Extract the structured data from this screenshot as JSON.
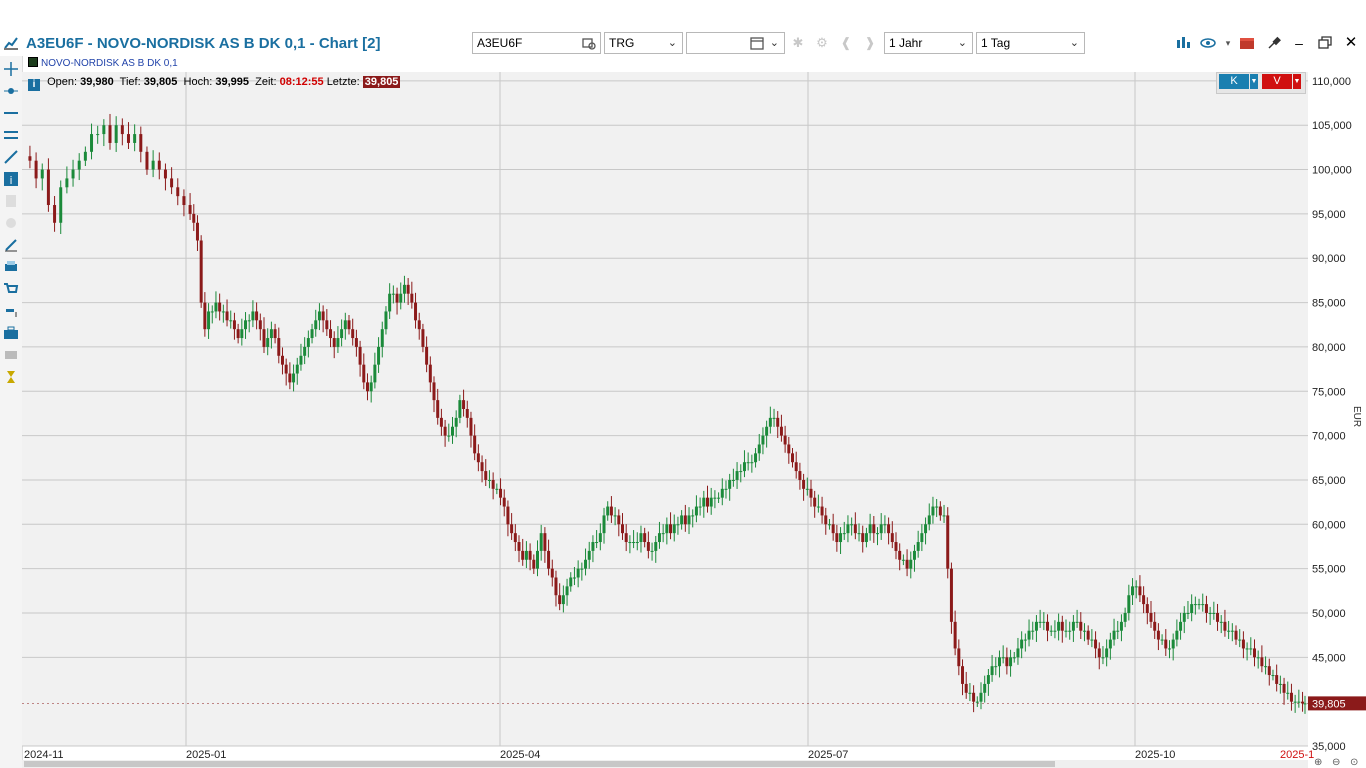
{
  "window": {
    "title": "A3EU6F - NOVO-NORDISK AS B  DK 0,1 - Chart [2]"
  },
  "toolbar": {
    "symbol_value": "A3EU6F",
    "exchange_value": "TRG",
    "date_value": "",
    "range_value": "1 Jahr",
    "interval_value": "1 Tag"
  },
  "series_label": "NOVO-NORDISK AS B  DK 0,1",
  "info": {
    "open_label": "Open:",
    "open_value": "39,980",
    "low_label": "Tief:",
    "low_value": "39,805",
    "high_label": "Hoch:",
    "high_value": "39,995",
    "time_label": "Zeit:",
    "time_value": "08:12:55",
    "last_label": "Letzte:",
    "last_value": "39,805"
  },
  "trade_buttons": {
    "buy": "K",
    "sell": "V"
  },
  "colors": {
    "up": "#1b8a3a",
    "down": "#8b1a1a",
    "grid": "#c8c8c8",
    "bg": "#f1f1f1",
    "last_price_bg": "#8b1a1a",
    "accent": "#1a6fa0"
  },
  "chart_data": {
    "type": "candlestick",
    "currency_label": "EUR",
    "ylim": [
      35,
      111
    ],
    "y_ticks": [
      "110,000",
      "105,000",
      "100,000",
      "95,000",
      "90,000",
      "85,000",
      "80,000",
      "75,000",
      "70,000",
      "65,000",
      "60,000",
      "55,000",
      "50,000",
      "45,000",
      "39,805",
      "35,000"
    ],
    "x_ticks": [
      "2024-11",
      "2025-01",
      "2025-04",
      "2025-07",
      "2025-10",
      "2025-1"
    ],
    "last_price": 39.805,
    "path_points": [
      [
        0,
        101.5
      ],
      [
        4,
        101
      ],
      [
        9,
        99
      ],
      [
        14,
        100
      ],
      [
        19,
        96
      ],
      [
        24,
        94
      ],
      [
        29,
        98
      ],
      [
        34,
        99
      ],
      [
        39,
        100
      ],
      [
        44,
        101
      ],
      [
        49,
        102
      ],
      [
        54,
        104
      ],
      [
        59,
        104
      ],
      [
        64,
        105
      ],
      [
        69,
        103
      ],
      [
        74,
        105
      ],
      [
        79,
        104
      ],
      [
        84,
        103
      ],
      [
        89,
        104
      ],
      [
        94,
        102
      ],
      [
        99,
        100
      ],
      [
        104,
        101
      ],
      [
        109,
        100
      ],
      [
        114,
        99
      ],
      [
        119,
        98
      ],
      [
        124,
        97
      ],
      [
        129,
        96
      ],
      [
        134,
        95
      ],
      [
        137,
        94
      ],
      [
        140,
        92
      ],
      [
        143,
        85
      ],
      [
        146,
        82
      ],
      [
        149,
        84
      ],
      [
        152,
        84
      ],
      [
        155,
        85
      ],
      [
        158,
        84
      ],
      [
        161,
        84
      ],
      [
        164,
        83
      ],
      [
        167,
        83
      ],
      [
        170,
        82
      ],
      [
        173,
        81
      ],
      [
        176,
        82
      ],
      [
        179,
        83
      ],
      [
        182,
        83
      ],
      [
        185,
        84
      ],
      [
        188,
        83
      ],
      [
        191,
        82
      ],
      [
        194,
        80
      ],
      [
        197,
        81
      ],
      [
        200,
        82
      ],
      [
        203,
        81
      ],
      [
        206,
        79
      ],
      [
        209,
        78
      ],
      [
        212,
        77
      ],
      [
        215,
        76
      ],
      [
        218,
        77
      ],
      [
        221,
        78
      ],
      [
        224,
        79
      ],
      [
        227,
        80
      ],
      [
        230,
        81
      ],
      [
        233,
        82
      ],
      [
        236,
        83
      ],
      [
        239,
        84
      ],
      [
        242,
        83
      ],
      [
        245,
        82
      ],
      [
        248,
        81
      ],
      [
        251,
        80
      ],
      [
        254,
        81
      ],
      [
        257,
        82
      ],
      [
        260,
        83
      ],
      [
        263,
        82
      ],
      [
        266,
        81
      ],
      [
        269,
        80
      ],
      [
        272,
        78
      ],
      [
        275,
        76
      ],
      [
        278,
        75
      ],
      [
        281,
        76
      ],
      [
        284,
        78
      ],
      [
        287,
        80
      ],
      [
        290,
        82
      ],
      [
        293,
        84
      ],
      [
        296,
        86
      ],
      [
        299,
        86
      ],
      [
        302,
        85
      ],
      [
        305,
        86
      ],
      [
        308,
        87
      ],
      [
        311,
        86
      ],
      [
        314,
        85
      ],
      [
        317,
        83
      ],
      [
        320,
        82
      ],
      [
        323,
        80
      ],
      [
        326,
        78
      ],
      [
        329,
        76
      ],
      [
        332,
        74
      ],
      [
        335,
        72
      ],
      [
        338,
        71
      ],
      [
        341,
        70
      ],
      [
        344,
        70
      ],
      [
        347,
        71
      ],
      [
        350,
        72
      ],
      [
        353,
        74
      ],
      [
        356,
        73
      ],
      [
        359,
        72
      ],
      [
        362,
        70
      ],
      [
        365,
        68
      ],
      [
        368,
        67
      ],
      [
        371,
        66
      ],
      [
        374,
        65
      ],
      [
        377,
        65
      ],
      [
        380,
        64
      ],
      [
        383,
        64
      ],
      [
        386,
        63
      ],
      [
        389,
        62
      ],
      [
        392,
        60
      ],
      [
        395,
        59
      ],
      [
        398,
        58
      ],
      [
        401,
        57
      ],
      [
        404,
        56
      ],
      [
        407,
        57
      ],
      [
        410,
        56
      ],
      [
        413,
        55
      ],
      [
        416,
        57
      ],
      [
        419,
        59
      ],
      [
        422,
        57
      ],
      [
        425,
        55
      ],
      [
        428,
        54
      ],
      [
        431,
        52
      ],
      [
        434,
        51
      ],
      [
        437,
        52
      ],
      [
        440,
        53
      ],
      [
        443,
        54
      ],
      [
        446,
        54
      ],
      [
        449,
        55
      ],
      [
        452,
        55
      ],
      [
        455,
        56
      ],
      [
        458,
        57
      ],
      [
        461,
        58
      ],
      [
        464,
        58
      ],
      [
        467,
        59
      ],
      [
        470,
        61
      ],
      [
        473,
        62
      ],
      [
        476,
        61
      ],
      [
        479,
        61
      ],
      [
        482,
        60
      ],
      [
        485,
        59
      ],
      [
        488,
        58
      ],
      [
        491,
        58
      ],
      [
        494,
        58
      ],
      [
        497,
        58
      ],
      [
        500,
        59
      ],
      [
        503,
        58
      ],
      [
        506,
        57
      ],
      [
        509,
        57
      ],
      [
        512,
        58
      ],
      [
        515,
        59
      ],
      [
        518,
        59
      ],
      [
        521,
        60
      ],
      [
        524,
        59
      ],
      [
        527,
        60
      ],
      [
        530,
        60
      ],
      [
        533,
        61
      ],
      [
        536,
        60
      ],
      [
        539,
        61
      ],
      [
        542,
        61
      ],
      [
        545,
        62
      ],
      [
        548,
        62
      ],
      [
        551,
        63
      ],
      [
        554,
        62
      ],
      [
        557,
        63
      ],
      [
        560,
        63
      ],
      [
        563,
        63
      ],
      [
        566,
        64
      ],
      [
        569,
        64
      ],
      [
        572,
        65
      ],
      [
        575,
        65
      ],
      [
        578,
        66
      ],
      [
        581,
        66
      ],
      [
        584,
        67
      ],
      [
        587,
        67
      ],
      [
        590,
        67
      ],
      [
        593,
        68
      ],
      [
        596,
        69
      ],
      [
        599,
        70
      ],
      [
        602,
        71
      ],
      [
        605,
        72
      ],
      [
        608,
        72
      ],
      [
        611,
        71
      ],
      [
        614,
        70
      ],
      [
        617,
        69
      ],
      [
        620,
        68
      ],
      [
        623,
        67
      ],
      [
        626,
        66
      ],
      [
        629,
        65
      ],
      [
        632,
        64
      ],
      [
        635,
        64
      ],
      [
        638,
        63
      ],
      [
        641,
        62
      ],
      [
        644,
        62
      ],
      [
        647,
        61
      ],
      [
        650,
        60
      ],
      [
        653,
        60
      ],
      [
        656,
        59
      ],
      [
        659,
        58
      ],
      [
        662,
        59
      ],
      [
        665,
        59
      ],
      [
        668,
        60
      ],
      [
        671,
        60
      ],
      [
        674,
        59
      ],
      [
        677,
        59
      ],
      [
        680,
        58
      ],
      [
        683,
        59
      ],
      [
        686,
        60
      ],
      [
        689,
        59
      ],
      [
        692,
        59
      ],
      [
        695,
        60
      ],
      [
        698,
        60
      ],
      [
        701,
        59
      ],
      [
        704,
        58
      ],
      [
        707,
        57
      ],
      [
        710,
        56
      ],
      [
        713,
        56
      ],
      [
        716,
        55
      ],
      [
        719,
        56
      ],
      [
        722,
        57
      ],
      [
        725,
        58
      ],
      [
        728,
        59
      ],
      [
        731,
        60
      ],
      [
        734,
        61
      ],
      [
        737,
        62
      ],
      [
        740,
        62
      ],
      [
        743,
        61
      ],
      [
        746,
        61
      ],
      [
        749,
        55
      ],
      [
        752,
        49
      ],
      [
        755,
        46
      ],
      [
        758,
        44
      ],
      [
        761,
        42
      ],
      [
        764,
        41
      ],
      [
        767,
        41
      ],
      [
        770,
        40
      ],
      [
        773,
        40
      ],
      [
        776,
        41
      ],
      [
        779,
        42
      ],
      [
        782,
        43
      ],
      [
        785,
        44
      ],
      [
        788,
        44
      ],
      [
        791,
        45
      ],
      [
        794,
        45
      ],
      [
        797,
        44
      ],
      [
        800,
        45
      ],
      [
        803,
        45
      ],
      [
        806,
        46
      ],
      [
        809,
        47
      ],
      [
        812,
        47
      ],
      [
        815,
        48
      ],
      [
        818,
        48
      ],
      [
        821,
        49
      ],
      [
        824,
        49
      ],
      [
        827,
        49
      ],
      [
        830,
        48
      ],
      [
        833,
        48
      ],
      [
        836,
        48
      ],
      [
        839,
        49
      ],
      [
        842,
        48
      ],
      [
        845,
        48
      ],
      [
        848,
        48
      ],
      [
        851,
        49
      ],
      [
        854,
        49
      ],
      [
        857,
        48
      ],
      [
        860,
        48
      ],
      [
        863,
        47
      ],
      [
        866,
        47
      ],
      [
        869,
        46
      ],
      [
        872,
        45
      ],
      [
        875,
        45
      ],
      [
        878,
        46
      ],
      [
        881,
        47
      ],
      [
        884,
        48
      ],
      [
        887,
        48
      ],
      [
        890,
        49
      ],
      [
        893,
        50
      ],
      [
        896,
        52
      ],
      [
        899,
        53
      ],
      [
        902,
        53
      ],
      [
        905,
        52
      ],
      [
        908,
        51
      ],
      [
        911,
        50
      ],
      [
        914,
        49
      ],
      [
        917,
        48
      ],
      [
        920,
        47
      ],
      [
        923,
        47
      ],
      [
        926,
        46
      ],
      [
        929,
        46
      ],
      [
        932,
        47
      ],
      [
        935,
        48
      ],
      [
        938,
        49
      ],
      [
        941,
        50
      ],
      [
        944,
        50
      ],
      [
        947,
        51
      ],
      [
        950,
        51
      ],
      [
        953,
        51
      ],
      [
        956,
        51
      ],
      [
        959,
        50
      ],
      [
        962,
        50
      ],
      [
        965,
        50
      ],
      [
        968,
        49
      ],
      [
        971,
        49
      ],
      [
        974,
        48
      ],
      [
        977,
        48
      ],
      [
        980,
        48
      ],
      [
        983,
        47
      ],
      [
        986,
        47
      ],
      [
        989,
        46
      ],
      [
        992,
        46
      ],
      [
        995,
        46
      ],
      [
        998,
        45
      ],
      [
        1001,
        45
      ],
      [
        1004,
        44
      ],
      [
        1007,
        44
      ],
      [
        1010,
        43
      ],
      [
        1013,
        43
      ],
      [
        1016,
        42
      ],
      [
        1019,
        42
      ],
      [
        1022,
        41
      ],
      [
        1025,
        41
      ],
      [
        1028,
        40
      ],
      [
        1031,
        40
      ],
      [
        1034,
        40
      ],
      [
        1037,
        39.8
      ],
      [
        1039,
        39.805
      ]
    ]
  }
}
